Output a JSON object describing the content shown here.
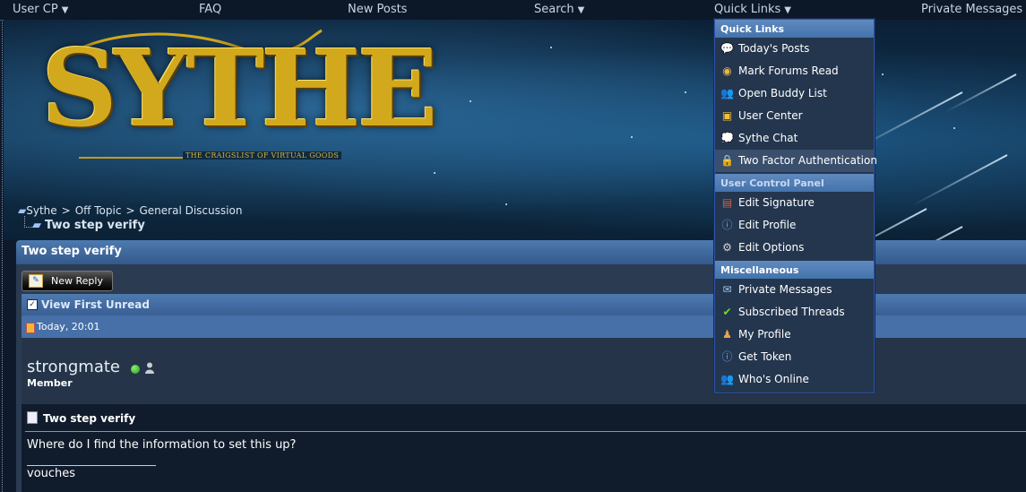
{
  "navbar": {
    "user_cp": "User CP",
    "faq": "FAQ",
    "new_posts": "New Posts",
    "search": "Search",
    "quick_links": "Quick Links",
    "private_messages": "Private Messages",
    "caret": "▼"
  },
  "banner": {
    "logo_text": "SYTHE",
    "tagline": "THE CRAIGSLIST OF VIRTUAL GOODS"
  },
  "breadcrumb": {
    "items": [
      "Sythe",
      "Off Topic",
      "General Discussion"
    ],
    "separator": ">",
    "current": "Two step verify"
  },
  "thread": {
    "title": "Two step verify",
    "new_reply_label": "New Reply",
    "view_first_unread": "View First Unread",
    "post_date": "Today, 20:01",
    "username": "strongmate",
    "user_rank": "Member",
    "post_title": "Two step verify",
    "message": "Where do I find the information to set this up?",
    "signature": "vouches"
  },
  "quick_links_menu": {
    "sections": [
      {
        "header": "Quick Links",
        "items": [
          {
            "label": "Today's Posts",
            "icon": "speech-bubble-icon"
          },
          {
            "label": "Mark Forums Read",
            "icon": "eye-icon"
          },
          {
            "label": "Open Buddy List",
            "icon": "buddies-icon"
          },
          {
            "label": "User Center",
            "icon": "user-center-icon"
          },
          {
            "label": "Sythe Chat",
            "icon": "chat-icon"
          },
          {
            "label": "Two Factor Authentication",
            "icon": "lock-icon"
          }
        ]
      },
      {
        "header": "User Control Panel",
        "items": [
          {
            "label": "Edit Signature",
            "icon": "signature-icon"
          },
          {
            "label": "Edit Profile",
            "icon": "info-icon"
          },
          {
            "label": "Edit Options",
            "icon": "gear-icon"
          }
        ]
      },
      {
        "header": "Miscellaneous",
        "items": [
          {
            "label": "Private Messages",
            "icon": "message-icon"
          },
          {
            "label": "Subscribed Threads",
            "icon": "checkmark-icon"
          },
          {
            "label": "My Profile",
            "icon": "profile-icon"
          },
          {
            "label": "Get Token",
            "icon": "info-icon"
          },
          {
            "label": "Who's Online",
            "icon": "buddies-icon"
          }
        ]
      }
    ]
  },
  "colors": {
    "header_blue": "#4d7ab0",
    "menu_bg": "#24364e",
    "logo_gold": "#d2a91c",
    "online_green": "#1f9a1f"
  }
}
